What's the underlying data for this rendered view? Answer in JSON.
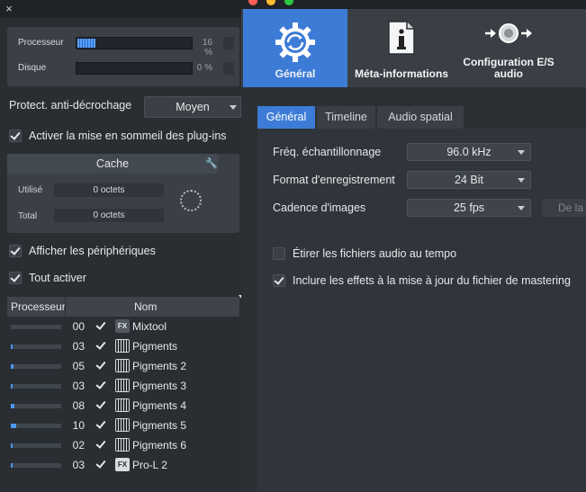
{
  "left_panel": {
    "close_glyph": "×",
    "performance": {
      "rows": [
        {
          "label": "Processeur",
          "percent_text": "16 %",
          "level": 0.16
        },
        {
          "label": "Disque",
          "percent_text": "0 %",
          "level": 0.0
        }
      ]
    },
    "anti_dropout": {
      "label": "Protect. anti-décrochage",
      "value": "Moyen"
    },
    "sleep_plugins": {
      "label": "Activer la mise en sommeil des plug-ins",
      "checked": true
    },
    "cache": {
      "title": "Cache",
      "used_label": "Utilisé",
      "used_value": "0 octets",
      "total_label": "Total",
      "total_value": "0 octets"
    },
    "show_devices": {
      "label": "Afficher les périphériques",
      "checked": true
    },
    "enable_all": {
      "label": "Tout activer",
      "checked": true
    },
    "plugin_table": {
      "headers": {
        "processor": "Processeur",
        "name": "Nom"
      },
      "rows": [
        {
          "load": 0.0,
          "num": "00",
          "icon": "fx-icon",
          "icon_text": "FX",
          "name": "Mixtool"
        },
        {
          "load": 0.03,
          "num": "03",
          "icon": "keyboard-icon",
          "icon_text": "",
          "name": "Pigments"
        },
        {
          "load": 0.05,
          "num": "05",
          "icon": "keyboard-icon",
          "icon_text": "",
          "name": "Pigments 2"
        },
        {
          "load": 0.03,
          "num": "03",
          "icon": "keyboard-icon",
          "icon_text": "",
          "name": "Pigments 3"
        },
        {
          "load": 0.08,
          "num": "08",
          "icon": "keyboard-icon",
          "icon_text": "",
          "name": "Pigments 4"
        },
        {
          "load": 0.1,
          "num": "10",
          "icon": "keyboard-icon",
          "icon_text": "",
          "name": "Pigments 5"
        },
        {
          "load": 0.02,
          "num": "02",
          "icon": "keyboard-icon",
          "icon_text": "",
          "name": "Pigments 6"
        },
        {
          "load": 0.03,
          "num": "03",
          "icon": "fx-icon",
          "icon_text": "FX",
          "name": "Pro-L 2"
        }
      ]
    }
  },
  "right_window": {
    "toolbar": {
      "general_label": "Général",
      "meta_label": "Méta-informations",
      "io_label_line1": "Configuration E/S",
      "io_label_line2": "audio"
    },
    "tabs": {
      "general": "Général",
      "timeline": "Timeline",
      "spatial": "Audio spatial"
    },
    "settings": {
      "sample_rate": {
        "label": "Fréq. échantillonnage",
        "value": "96.0 kHz"
      },
      "record_format": {
        "label": "Format d'enregistrement",
        "value": "24 Bit"
      },
      "frame_rate": {
        "label": "Cadence d'images",
        "value": "25 fps",
        "extra_button": "De la"
      }
    },
    "options": {
      "stretch": {
        "label": "Étirer les fichiers audio au tempo",
        "checked": false
      },
      "include_fx": {
        "label": "Inclure les effets à la mise à jour du fichier de mastering",
        "checked": true
      }
    }
  },
  "colors": {
    "accent": "#3d7cd6",
    "meter": "#4d97f0"
  }
}
